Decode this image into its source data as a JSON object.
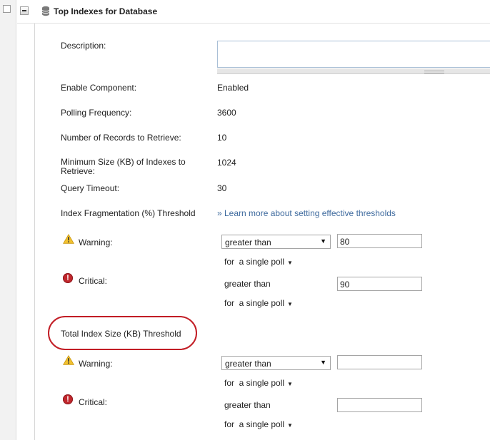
{
  "header": {
    "title": "Top Indexes for Database"
  },
  "fields": {
    "description_label": "Description:",
    "description_value": "",
    "enable_label": "Enable Component:",
    "enable_value": "Enabled",
    "polling_label": "Polling Frequency:",
    "polling_value": "3600",
    "records_label": "Number of Records to Retrieve:",
    "records_value": "10",
    "minsize_label": "Minimum Size (KB) of Indexes to Retrieve:",
    "minsize_value": "1024",
    "timeout_label": "Query Timeout:",
    "timeout_value": "30"
  },
  "fragmentation": {
    "title": "Index Fragmentation (%) Threshold",
    "learn_more": "» Learn more about setting effective thresholds",
    "warning": {
      "label": "Warning:",
      "operator": "greater than",
      "value": "80",
      "poll": "for  a single poll"
    },
    "critical": {
      "label": "Critical:",
      "operator": "greater than",
      "value": "90",
      "poll": "for  a single poll"
    }
  },
  "total_size": {
    "title": "Total Index Size (KB) Threshold",
    "warning": {
      "label": "Warning:",
      "operator": "greater than",
      "value": "",
      "poll": "for  a single poll"
    },
    "critical": {
      "label": "Critical:",
      "operator": "greater than",
      "value": "",
      "poll": "for  a single poll"
    }
  },
  "icons": {
    "header": "database-icon",
    "warning": "warning-icon",
    "critical": "critical-icon",
    "collapse": "collapse-icon"
  },
  "colors": {
    "link": "#3e6a9e",
    "highlight": "#c21d25",
    "warning": "#f2c230",
    "critical": "#c1272d"
  }
}
